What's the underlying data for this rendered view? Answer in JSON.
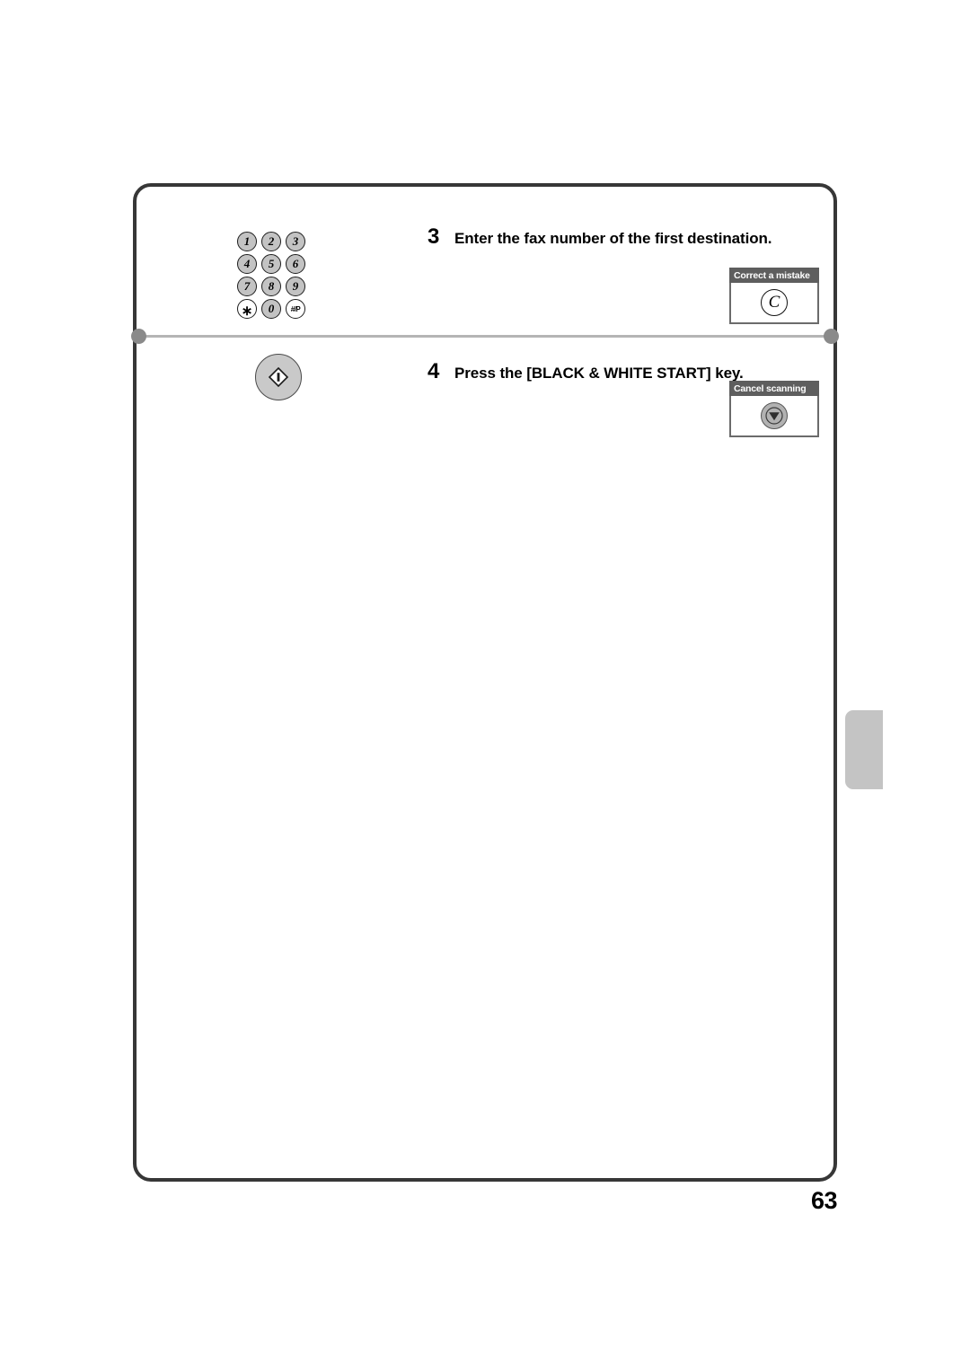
{
  "document": {
    "page_number": "63"
  },
  "steps": [
    {
      "number": "3",
      "text": "Enter the fax number of the first destination.",
      "callout": {
        "title": "Correct a mistake",
        "key_label": "C",
        "icon": "clear-key-icon"
      },
      "illustration": "numeric-keypad"
    },
    {
      "number": "4",
      "text": "Press the [BLACK & WHITE START] key.",
      "callout": {
        "title": "Cancel scanning",
        "key_label": "",
        "icon": "stop-key-icon"
      },
      "illustration": "black-white-start-key"
    }
  ],
  "keypad": {
    "rows": [
      [
        {
          "label": "1",
          "style": "filled"
        },
        {
          "label": "2",
          "style": "filled"
        },
        {
          "label": "3",
          "style": "filled"
        }
      ],
      [
        {
          "label": "4",
          "style": "filled"
        },
        {
          "label": "5",
          "style": "filled"
        },
        {
          "label": "6",
          "style": "filled"
        }
      ],
      [
        {
          "label": "7",
          "style": "filled"
        },
        {
          "label": "8",
          "style": "filled"
        },
        {
          "label": "9",
          "style": "filled"
        }
      ],
      [
        {
          "label": "∗",
          "style": "light"
        },
        {
          "label": "0",
          "style": "filled"
        },
        {
          "label": "#/P",
          "style": "light"
        }
      ]
    ]
  },
  "colors": {
    "frame_border": "#373737",
    "callout_title_bg": "#5e5e5e",
    "key_fill": "#c3c3c3",
    "separator": "#b5b5b5",
    "separator_dot": "#8a8a8a",
    "chapter_tab": "#c4c4c4"
  }
}
